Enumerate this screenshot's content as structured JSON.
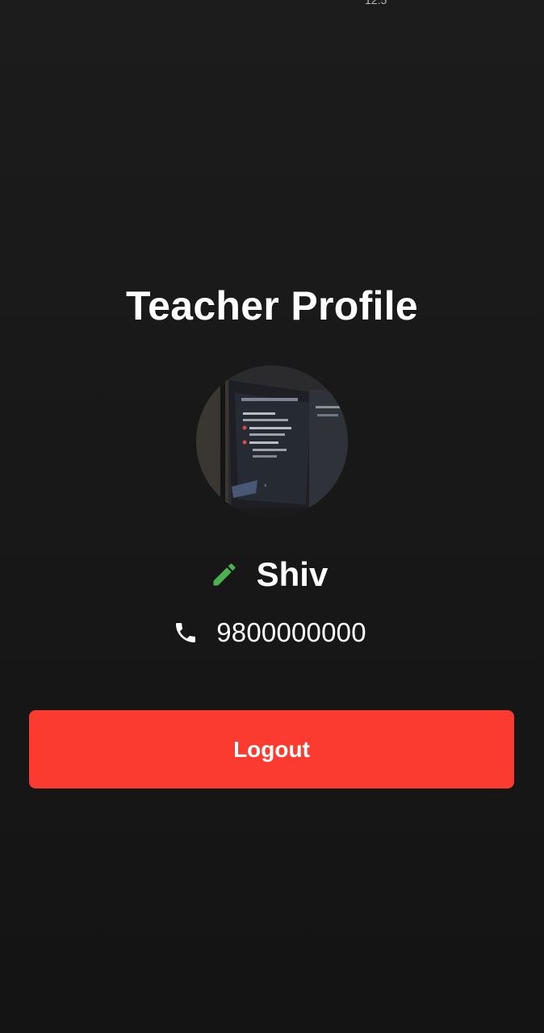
{
  "status_bar": {
    "fragment": "12:5"
  },
  "profile": {
    "title": "Teacher Profile",
    "name": "Shiv",
    "phone": "9800000000"
  },
  "icons": {
    "edit": "pencil-icon",
    "phone": "phone-icon"
  },
  "actions": {
    "logout_label": "Logout"
  },
  "colors": {
    "background": "#171717",
    "edit_icon": "#4caf50",
    "logout": "#fb3b30",
    "text": "#ffffff"
  }
}
